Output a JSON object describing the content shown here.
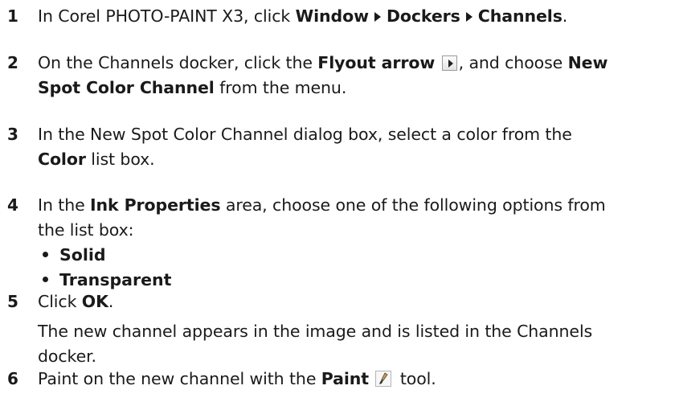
{
  "steps": [
    {
      "number": "1",
      "parts": {
        "a": "In Corel PHOTO-PAINT X3, click ",
        "window": "Window",
        "dockers": "Dockers",
        "channels": "Channels",
        "end": "."
      }
    },
    {
      "number": "2",
      "parts": {
        "a": "On the Channels docker, click the ",
        "flyout": "Flyout arrow",
        "b": ", and choose ",
        "new": "New",
        "spot": "Spot Color Channel",
        "c": " from the menu."
      },
      "icon": "flyout-arrow-icon"
    },
    {
      "number": "3",
      "parts": {
        "a": "In the New Spot Color Channel dialog box, select a color from the",
        "color": "Color",
        "b": " list box."
      }
    },
    {
      "number": "4",
      "parts": {
        "a": "In the ",
        "ink": "Ink Properties",
        "b": " area, choose one of the following options from",
        "c": "the list box:"
      },
      "options": [
        "Solid",
        "Transparent"
      ]
    },
    {
      "number": "5",
      "parts": {
        "a": "Click ",
        "ok": "OK",
        "end": ".",
        "r1": "The new channel appears in the image and is listed in the Channels",
        "r2": "docker."
      }
    },
    {
      "number": "6",
      "parts": {
        "a": "Paint on the new channel with the ",
        "paint": "Paint",
        "b": " tool."
      },
      "icon": "paint-tool-icon"
    }
  ]
}
